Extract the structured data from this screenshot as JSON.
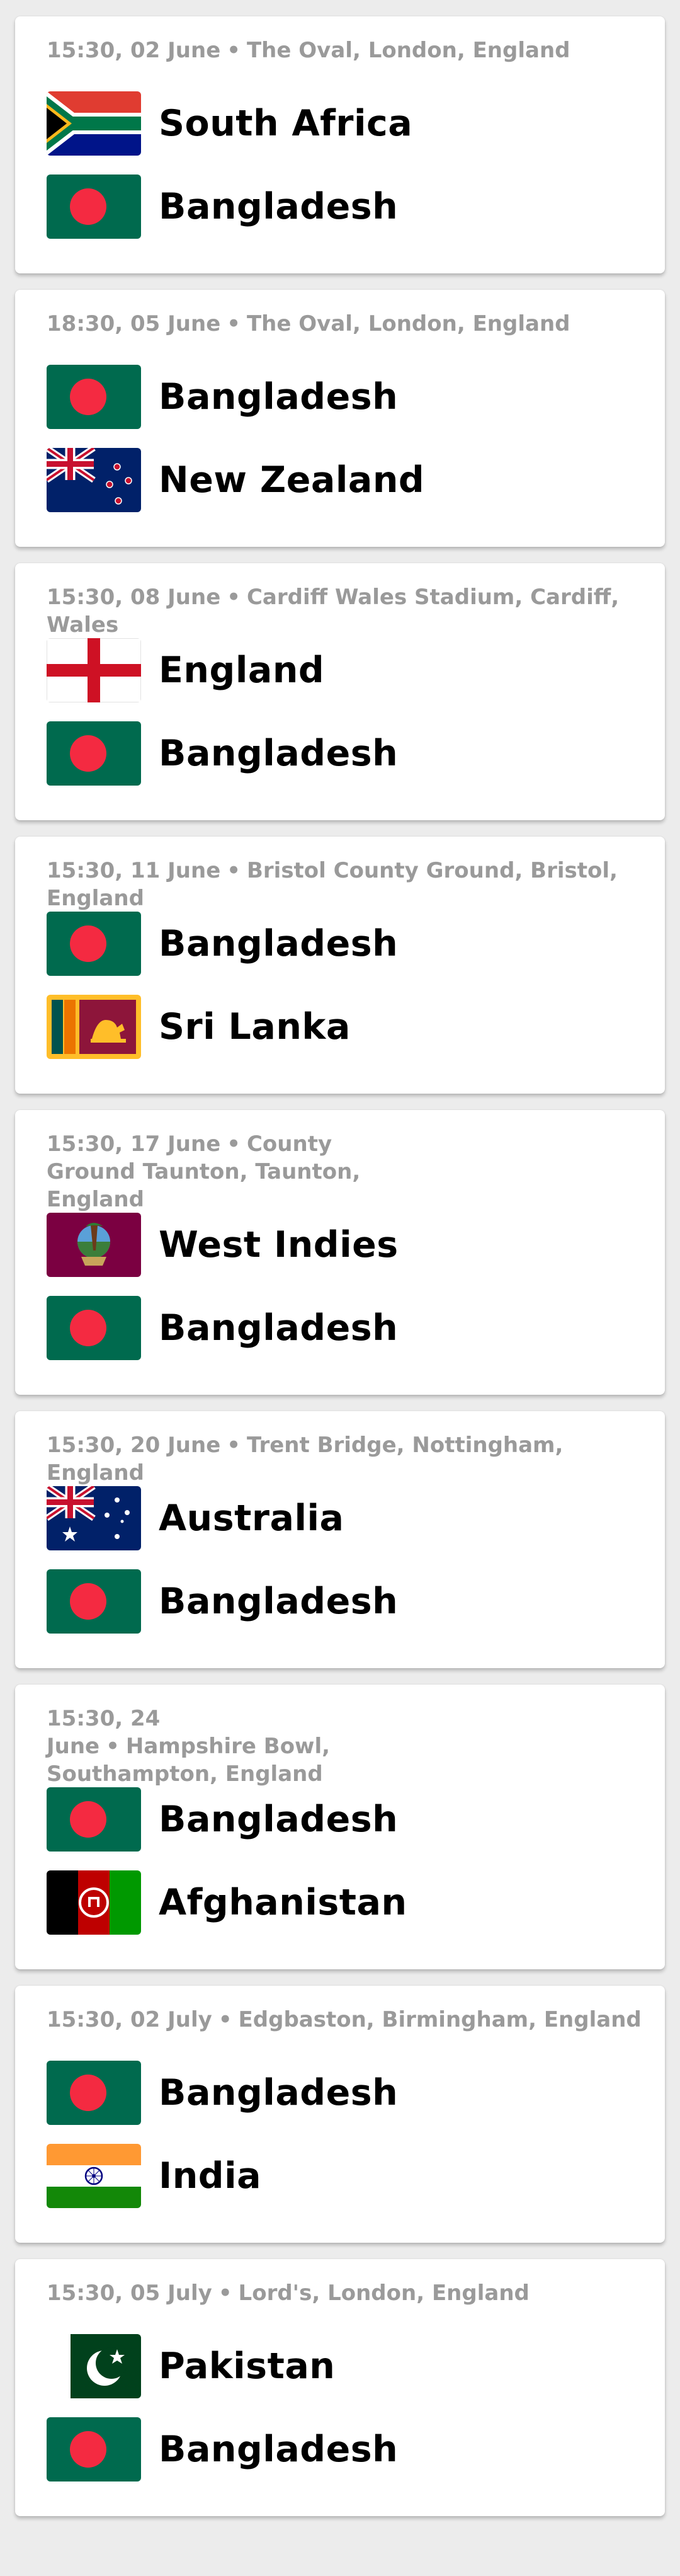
{
  "matches": [
    {
      "time": "15:30, 02 June",
      "venue": "The Oval, London, England",
      "team1": {
        "name": "South Africa",
        "flag": "south-africa-flag"
      },
      "team2": {
        "name": "Bangladesh",
        "flag": "bangladesh-flag"
      }
    },
    {
      "time": "18:30, 05 June",
      "venue": "The Oval, London, England",
      "team1": {
        "name": "Bangladesh",
        "flag": "bangladesh-flag"
      },
      "team2": {
        "name": "New Zealand",
        "flag": "new-zealand-flag"
      }
    },
    {
      "time": "15:30, 08 June",
      "venue": "Cardiff Wales Stadium, Cardiff, Wales",
      "team1": {
        "name": "England",
        "flag": "england-flag"
      },
      "team2": {
        "name": "Bangladesh",
        "flag": "bangladesh-flag"
      }
    },
    {
      "time": "15:30, 11 June",
      "venue": "Bristol County Ground, Bristol, England",
      "team1": {
        "name": "Bangladesh",
        "flag": "bangladesh-flag"
      },
      "team2": {
        "name": "Sri Lanka",
        "flag": "sri-lanka-flag"
      }
    },
    {
      "time": "15:30, 17 June",
      "venue": "County Ground Taunton, Taunton, England",
      "team1": {
        "name": "West Indies",
        "flag": "west-indies-flag"
      },
      "team2": {
        "name": "Bangladesh",
        "flag": "bangladesh-flag"
      }
    },
    {
      "time": "15:30, 20 June",
      "venue": "Trent Bridge, Nottingham, England",
      "team1": {
        "name": "Australia",
        "flag": "australia-flag"
      },
      "team2": {
        "name": "Bangladesh",
        "flag": "bangladesh-flag"
      }
    },
    {
      "time": "15:30, 24 June",
      "venue": "Hampshire Bowl, Southampton, England",
      "team1": {
        "name": "Bangladesh",
        "flag": "bangladesh-flag"
      },
      "team2": {
        "name": "Afghanistan",
        "flag": "afghanistan-flag"
      }
    },
    {
      "time": "15:30, 02 July",
      "venue": "Edgbaston, Birmingham, England",
      "team1": {
        "name": "Bangladesh",
        "flag": "bangladesh-flag"
      },
      "team2": {
        "name": "India",
        "flag": "india-flag"
      }
    },
    {
      "time": "15:30, 05 July",
      "venue": "Lord's, London, England",
      "team1": {
        "name": "Pakistan",
        "flag": "pakistan-flag"
      },
      "team2": {
        "name": "Bangladesh",
        "flag": "bangladesh-flag"
      }
    }
  ],
  "separator": "•"
}
